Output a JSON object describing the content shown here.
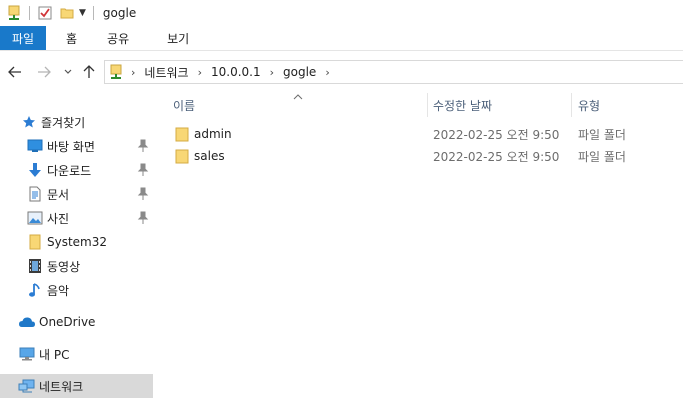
{
  "window": {
    "title": "gogle"
  },
  "ribbon": {
    "tabs": [
      {
        "label": "파일"
      },
      {
        "label": "홈"
      },
      {
        "label": "공유"
      },
      {
        "label": "보기"
      }
    ]
  },
  "address": {
    "crumbs": [
      "네트워크",
      "10.0.0.1",
      "gogle"
    ]
  },
  "nav": {
    "quick_access": "즐겨찾기",
    "items": [
      {
        "label": "바탕 화면",
        "icon": "desktop-icon",
        "pinned": true
      },
      {
        "label": "다운로드",
        "icon": "download-icon",
        "pinned": true
      },
      {
        "label": "문서",
        "icon": "document-icon",
        "pinned": true
      },
      {
        "label": "사진",
        "icon": "pictures-icon",
        "pinned": true
      },
      {
        "label": "System32",
        "icon": "folder-icon",
        "pinned": false
      },
      {
        "label": "동영상",
        "icon": "video-icon",
        "pinned": false
      },
      {
        "label": "음악",
        "icon": "music-icon",
        "pinned": false
      }
    ],
    "onedrive": "OneDrive",
    "thispc": "내 PC",
    "network": "네트워크"
  },
  "list": {
    "columns": {
      "name": "이름",
      "date": "수정한 날짜",
      "type": "유형"
    },
    "rows": [
      {
        "name": "admin",
        "date": "2022-02-25 오전 9:50",
        "type": "파일 폴더"
      },
      {
        "name": "sales",
        "date": "2022-02-25 오전 9:50",
        "type": "파일 폴더"
      }
    ]
  },
  "colors": {
    "accent": "#1979ca",
    "selection": "#d9d9d9",
    "folder": "#f8d775"
  }
}
